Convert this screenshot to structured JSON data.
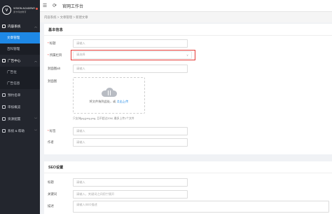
{
  "sidebar": {
    "logo_mark": "V",
    "logo_title": "VISION ACADEMY",
    "logo_subtitle": "通卡科技教育",
    "groups": [
      {
        "label": "内容系统",
        "expanded": true,
        "items": [
          "文章管理",
          "百科管理"
        ]
      },
      {
        "label": "广告中心",
        "expanded": true,
        "items": [
          "广告位",
          "广告信息"
        ]
      },
      {
        "label": "预约名单"
      },
      {
        "label": "审核概览"
      },
      {
        "label": "资源配置"
      },
      {
        "label": "系统 & 帮助"
      }
    ],
    "active_item": "文章管理"
  },
  "topbar": {
    "title": "官网工作台"
  },
  "breadcrumb": "内容系统 > 文章管理 > 新建文章",
  "basic": {
    "heading": "基本信息",
    "fields": [
      {
        "label": "标题",
        "required": true,
        "placeholder": "请输入"
      },
      {
        "label": "所属栏目",
        "required": true,
        "placeholder": "请选择"
      },
      {
        "label": "封面图alt",
        "required": false,
        "placeholder": "请输入"
      }
    ],
    "cover_label": "封面图",
    "upload_text": "将文件拖到此处，或",
    "upload_link": "点击上传",
    "upload_hint": "只支持jpg,jpeg,png, 且不超过20M, 最多上传1个文件",
    "tag_label": "标签",
    "tag_placeholder": "请输入",
    "author_label": "作者",
    "author_placeholder": "请输入"
  },
  "seo": {
    "heading": "SEO设置",
    "fields": [
      {
        "label": "标题",
        "placeholder": "请输入"
      },
      {
        "label": "关键词",
        "placeholder": "请输入，关键词之间用\"|\"隔开"
      },
      {
        "label": "描述",
        "placeholder": "请输入SEO描述"
      }
    ]
  },
  "colors": {
    "sidebar_bg": "#23262e",
    "active_nav": "#1e88e5",
    "highlight_border": "#e53935"
  }
}
